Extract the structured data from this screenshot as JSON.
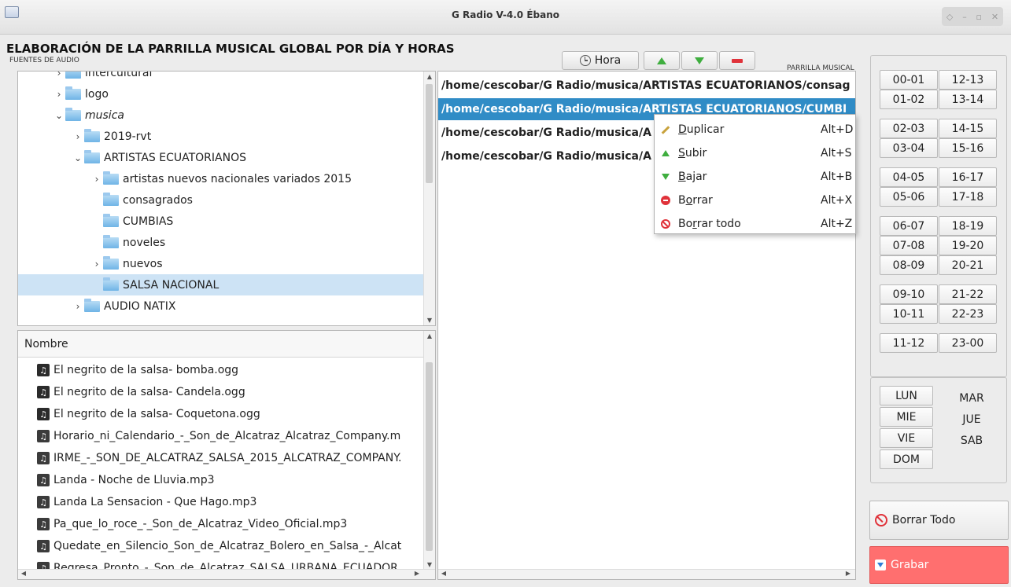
{
  "window": {
    "title": "G Radio V-4.0 Ébano"
  },
  "heading": "ELABORACIÓN DE LA PARRILLA MUSICAL GLOBAL POR DÍA Y HORAS",
  "labels": {
    "audio_sources": "FUENTES DE AUDIO",
    "music_grid": "PARRILLA MUSICAL"
  },
  "toolbar": {
    "hora_label": "Hora"
  },
  "tree": {
    "items": [
      {
        "label": "intercultural",
        "expand": "›",
        "italic": false
      },
      {
        "label": "logo",
        "expand": "›",
        "italic": false
      },
      {
        "label": "musica",
        "expand": "⌄",
        "italic": true
      },
      {
        "label": "2019-rvt",
        "expand": "›",
        "italic": false
      },
      {
        "label": "ARTISTAS ECUATORIANOS",
        "expand": "⌄",
        "italic": false
      },
      {
        "label": "artistas nuevos nacionales variados 2015",
        "expand": "›",
        "italic": false
      },
      {
        "label": "consagrados",
        "expand": "",
        "italic": false
      },
      {
        "label": "CUMBIAS",
        "expand": "",
        "italic": false
      },
      {
        "label": "noveles",
        "expand": "",
        "italic": false
      },
      {
        "label": "nuevos",
        "expand": "›",
        "italic": false
      },
      {
        "label": "SALSA NACIONAL",
        "expand": "",
        "italic": false,
        "selected": true
      },
      {
        "label": "AUDIO NATIX",
        "expand": "›",
        "italic": false
      }
    ]
  },
  "files": {
    "header": "Nombre",
    "items": [
      {
        "name": "El negrito de la salsa- bomba.ogg",
        "type": "ogg"
      },
      {
        "name": "El negrito de la salsa- Candela.ogg",
        "type": "ogg"
      },
      {
        "name": "El negrito de la salsa- Coquetona.ogg",
        "type": "ogg"
      },
      {
        "name": "Horario_ni_Calendario_-_Son_de_Alcatraz_Alcatraz_Company.m",
        "type": "mp3"
      },
      {
        "name": "IRME_-_SON_DE_ALCATRAZ_SALSA_2015_ALCATRAZ_COMPANY.",
        "type": "mp3"
      },
      {
        "name": "Landa - Noche de Lluvia.mp3",
        "type": "mp3"
      },
      {
        "name": "Landa La Sensacion - Que Hago.mp3",
        "type": "mp3"
      },
      {
        "name": "Pa_que_lo_roce_-_Son_de_Alcatraz_Video_Oficial.mp3",
        "type": "mp3"
      },
      {
        "name": "Quedate_en_Silencio_Son_de_Alcatraz_Bolero_en_Salsa_-_Alcat",
        "type": "mp3"
      },
      {
        "name": "Regresa_Pronto_-_Son_de_Alcatraz_SALSA_URBANA_ECUADOR",
        "type": "mp3"
      }
    ]
  },
  "playlist": {
    "items": [
      {
        "path": "/home/cescobar/G Radio/musica/ARTISTAS ECUATORIANOS/consag"
      },
      {
        "path": "/home/cescobar/G Radio/musica/ARTISTAS ECUATORIANOS/CUMBI",
        "selected": true
      },
      {
        "path": "/home/cescobar/G Radio/musica/A"
      },
      {
        "path": "/home/cescobar/G Radio/musica/A"
      }
    ]
  },
  "context_menu": {
    "items": [
      {
        "pre": "",
        "key": "D",
        "post": "uplicar",
        "shortcut": "Alt+D",
        "icon": "pencil-icon"
      },
      {
        "pre": "",
        "key": "S",
        "post": "ubir",
        "shortcut": "Alt+S",
        "icon": "arrow-up-icon"
      },
      {
        "pre": "",
        "key": "B",
        "post": "ajar",
        "shortcut": "Alt+B",
        "icon": "arrow-down-icon"
      },
      {
        "pre": "B",
        "key": "o",
        "post": "rrar",
        "shortcut": "Alt+X",
        "icon": "stop-icon"
      },
      {
        "pre": "Bo",
        "key": "r",
        "post": "rar todo",
        "shortcut": "Alt+Z",
        "icon": "ban-icon"
      }
    ]
  },
  "hours": {
    "left": [
      "00-01",
      "01-02",
      "02-03",
      "03-04",
      "04-05",
      "05-06",
      "06-07",
      "07-08",
      "08-09",
      "09-10",
      "10-11",
      "11-12"
    ],
    "right": [
      "12-13",
      "13-14",
      "14-15",
      "15-16",
      "16-17",
      "17-18",
      "18-19",
      "19-20",
      "20-21",
      "21-22",
      "22-23",
      "23-00"
    ]
  },
  "days": {
    "left": [
      "LUN",
      "MIE",
      "VIE",
      "DOM"
    ],
    "right": [
      "MAR",
      "JUE",
      "SAB"
    ]
  },
  "actions": {
    "clear_all": "Borrar Todo",
    "save": "Grabar"
  },
  "colors": {
    "selection": "#308cc6",
    "tree_selection": "#cde3f5",
    "save_button": "#ff6f6f",
    "accent_red": "#e0323a",
    "accent_green": "#3fae3f"
  }
}
